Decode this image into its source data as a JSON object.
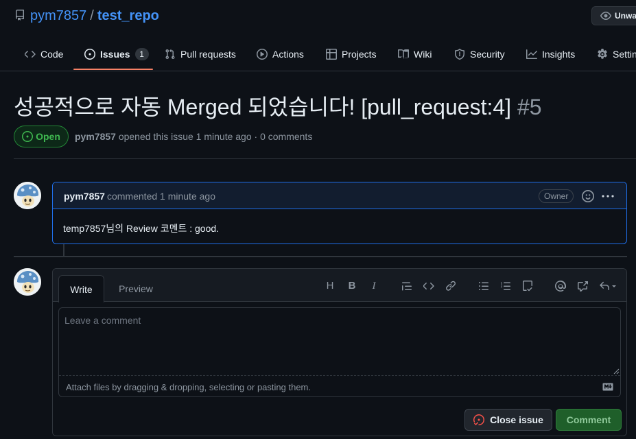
{
  "repo": {
    "owner": "pym7857",
    "separator": "/",
    "name": "test_repo",
    "watch_label": "Unwatch"
  },
  "nav": {
    "tabs": [
      {
        "label": "Code",
        "icon": "code-icon"
      },
      {
        "label": "Issues",
        "icon": "issue-opened-icon",
        "count": "1",
        "active": true
      },
      {
        "label": "Pull requests",
        "icon": "git-pull-request-icon"
      },
      {
        "label": "Actions",
        "icon": "play-icon"
      },
      {
        "label": "Projects",
        "icon": "table-icon"
      },
      {
        "label": "Wiki",
        "icon": "book-icon"
      },
      {
        "label": "Security",
        "icon": "shield-icon"
      },
      {
        "label": "Insights",
        "icon": "graph-icon"
      },
      {
        "label": "Settings",
        "icon": "gear-icon"
      }
    ]
  },
  "issue": {
    "title": "성공적으로 자동 Merged 되었습니다! [pull_request:4]",
    "number": "#5",
    "state": "Open",
    "author": "pym7857",
    "meta_text": "opened this issue 1 minute ago · 0 comments"
  },
  "comment": {
    "author": "pym7857",
    "time": "commented 1 minute ago",
    "role_badge": "Owner",
    "body": "temp7857님의 Review 코멘트 : good."
  },
  "composer": {
    "tab_write": "Write",
    "tab_preview": "Preview",
    "placeholder": "Leave a comment",
    "attach_hint": "Attach files by dragging & dropping, selecting or pasting them.",
    "close_label": "Close issue",
    "submit_label": "Comment",
    "toolbar": [
      "heading-icon",
      "bold-icon",
      "italic-icon",
      "quote-icon",
      "code-icon",
      "link-icon",
      "unordered-list-icon",
      "ordered-list-icon",
      "task-list-icon",
      "mention-icon",
      "cross-reference-icon",
      "reply-icon"
    ]
  },
  "colors": {
    "background": "#0d1117",
    "link": "#4493f8",
    "open_green": "#3fb950",
    "tab_underline": "#f78166",
    "comment_border": "#1f6feb"
  }
}
